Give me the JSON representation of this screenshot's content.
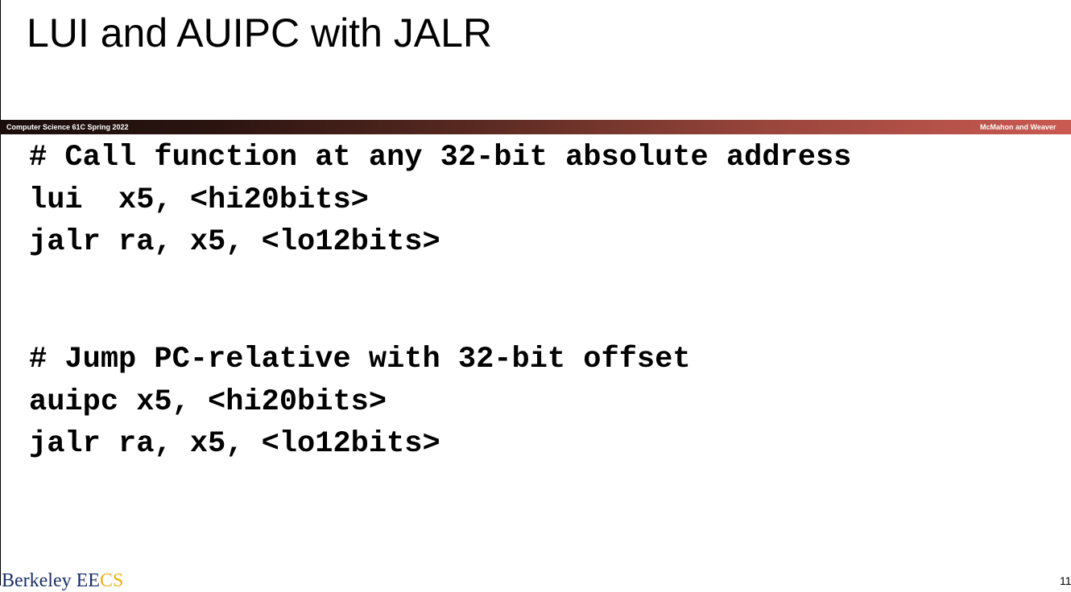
{
  "slide": {
    "title": "LUI and AUIPC with JALR"
  },
  "banner": {
    "left_text": "Computer Science 61C Spring 2022",
    "right_text": "McMahon and Weaver"
  },
  "code": {
    "lines": [
      "# Call function at any 32-bit absolute address",
      "lui  x5, <hi20bits>",
      "jalr ra, x5, <lo12bits>",
      "# Jump PC-relative with 32-bit offset",
      "auipc x5, <hi20bits>",
      "jalr ra, x5, <lo12bits>"
    ]
  },
  "footer": {
    "logo_berkeley": "Berkeley ",
    "logo_ee": "EE",
    "logo_cs": "CS",
    "page_number": "11"
  },
  "colors": {
    "banner_start": "#1a0e0c",
    "banner_end": "#c95a52",
    "logo_blue": "#1b2f66",
    "logo_gold": "#e6b313"
  }
}
